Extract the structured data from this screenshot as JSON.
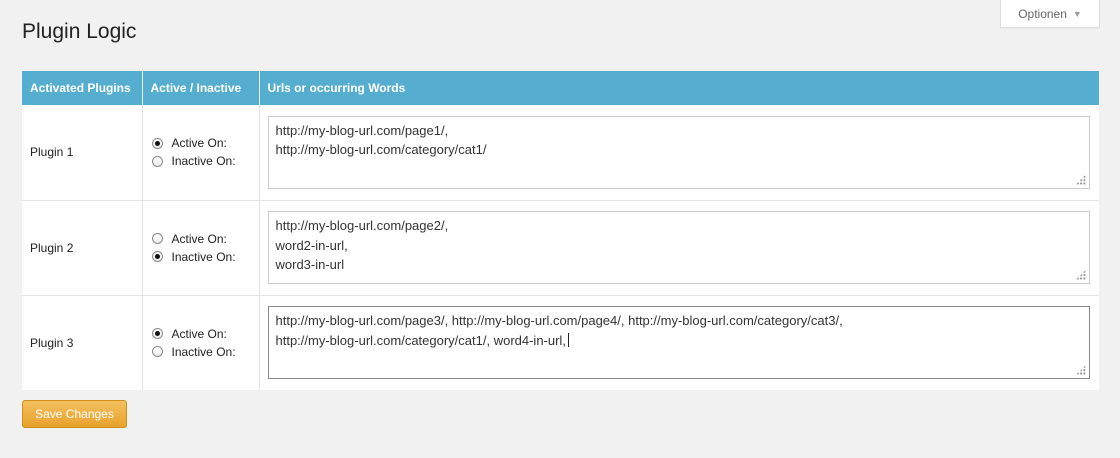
{
  "header": {
    "title": "Plugin Logic",
    "options_label": "Optionen",
    "options_icon": "triangle-down-icon"
  },
  "table": {
    "columns": [
      "Activated Plugins",
      "Active / Inactive",
      "Urls or occurring Words"
    ],
    "header_color": "#55aed0",
    "rows": [
      {
        "name": "Plugin 1",
        "options": [
          "Active On:",
          "Inactive On:"
        ],
        "selected": "Active On:",
        "text_lines": [
          "http://my-blog-url.com/page1/,",
          "http://my-blog-url.com/category/cat1/"
        ]
      },
      {
        "name": "Plugin 2",
        "options": [
          "Active On:",
          "Inactive On:"
        ],
        "selected": "Inactive On:",
        "text_lines": [
          "http://my-blog-url.com/page2/,",
          "word2-in-url,",
          "word3-in-url"
        ]
      },
      {
        "name": "Plugin 3",
        "options": [
          "Active On:",
          "Inactive On:"
        ],
        "selected": "Active On:",
        "text_lines": [
          "http://my-blog-url.com/page3/, http://my-blog-url.com/page4/, http://my-blog-url.com/category/cat3/,",
          "http://my-blog-url.com/category/cat1/, word4-in-url,"
        ]
      }
    ]
  },
  "footer": {
    "save_label": "Save Changes",
    "save_color": "#eaa63a"
  }
}
